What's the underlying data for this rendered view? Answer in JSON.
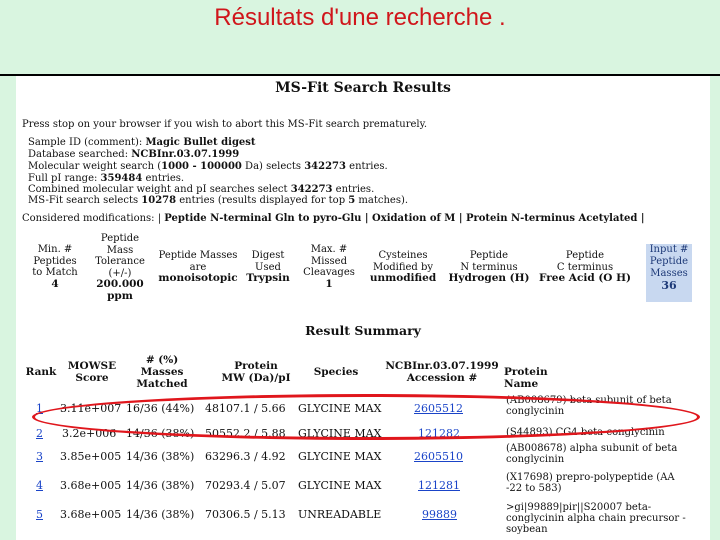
{
  "slide": {
    "title": "Résultats d'une recherche ."
  },
  "page": {
    "heading": "MS-Fit Search Results",
    "stop_note": "Press stop on your browser if you wish to abort this MS-Fit search prematurely.",
    "sample_id_label": "Sample ID (comment): ",
    "sample_id_value": "Magic Bullet digest",
    "database_label": "Database searched: ",
    "database_value": "NCBInr.03.07.1999",
    "mw_search_label": "Molecular weight search (",
    "mw_search_range": "1000 - 100000",
    "mw_search_mid": " Da) selects ",
    "mw_search_count": "342273",
    "mw_search_tail": " entries.",
    "pi_range_label": "Full pI range: ",
    "pi_range_value": "359484",
    "pi_range_tail": " entries.",
    "combined_label": "Combined molecular weight and pI searches select ",
    "combined_value": "342273",
    "combined_tail": " entries.",
    "msfit_label": "MS-Fit search selects ",
    "msfit_value": "10278",
    "msfit_mid": " entries (results displayed for top ",
    "msfit_top": "5",
    "msfit_tail": " matches).",
    "mods_label": "Considered modifications: | ",
    "mods_value": "Peptide N-terminal Gln to pyro-Glu | Oxidation of M | Protein N-terminus Acetylated |"
  },
  "params": {
    "min_peptides_label": [
      "Min. #",
      "Peptides",
      "to Match"
    ],
    "min_peptides_value": "4",
    "tolerance_label": [
      "Peptide",
      "Mass",
      "Tolerance",
      "(+/-)"
    ],
    "tolerance_value": [
      "200.000",
      "ppm"
    ],
    "masses_label": [
      "Peptide Masses",
      "are"
    ],
    "masses_value": "monoisotopic",
    "digest_label": [
      "Digest",
      "Used"
    ],
    "digest_value": "Trypsin",
    "cleavages_label": [
      "Max. #",
      "Missed",
      "Cleavages"
    ],
    "cleavages_value": "1",
    "cysteines_label": [
      "Cysteines",
      "Modified by"
    ],
    "cysteines_value": "unmodified",
    "nterm_label": [
      "Peptide",
      "N terminus"
    ],
    "nterm_value": "Hydrogen (H)",
    "cterm_label": [
      "Peptide",
      "C terminus"
    ],
    "cterm_value": "Free Acid (O H)",
    "input_label": [
      "Input #",
      "Peptide",
      "Masses"
    ],
    "input_value": "36"
  },
  "summary": {
    "title": "Result Summary",
    "headers": {
      "rank": "Rank",
      "score": [
        "MOWSE",
        "Score"
      ],
      "masses": [
        "# (%)",
        "Masses",
        "Matched"
      ],
      "mw": [
        "Protein",
        "MW (Da)/pI"
      ],
      "species": "Species",
      "accession": [
        "NCBInr.03.07.1999",
        "Accession #"
      ],
      "name": "Protein Name"
    },
    "rows": [
      {
        "rank": "1",
        "score": "3.11e+007",
        "masses": "16/36 (44%)",
        "mw": "48107.1 / 5.66",
        "species": "GLYCINE MAX",
        "accession": "2605512",
        "name": "(AB008679) beta subunit of beta conglycinin"
      },
      {
        "rank": "2",
        "score": "3.2e+006",
        "masses": "14/36 (38%)",
        "mw": "50552.2 / 5.88",
        "species": "GLYCINE MAX",
        "accession": "121282",
        "name": "(S44893) CG4 beta-conglycinin"
      },
      {
        "rank": "3",
        "score": "3.85e+005",
        "masses": "14/36 (38%)",
        "mw": "63296.3 / 4.92",
        "species": "GLYCINE MAX",
        "accession": "2605510",
        "name": "(AB008678) alpha subunit of beta conglycinin"
      },
      {
        "rank": "4",
        "score": "3.68e+005",
        "masses": "14/36 (38%)",
        "mw": "70293.4 / 5.07",
        "species": "GLYCINE MAX",
        "accession": "121281",
        "name": "(X17698) prepro-polypeptide (AA -22 to 583)"
      },
      {
        "rank": "5",
        "score": "3.68e+005",
        "masses": "14/36 (38%)",
        "mw": "70306.5 / 5.13",
        "species": "UNREADABLE",
        "accession": "99889",
        "name": ">gi|99889|pir||S20007 beta-conglycinin alpha chain precursor - soybean"
      }
    ]
  },
  "colors": {
    "title_red": "#d0161b",
    "highlight_red": "#e0161c",
    "link_blue": "#1a44c8",
    "slide_bg": "#d9f5e0"
  }
}
